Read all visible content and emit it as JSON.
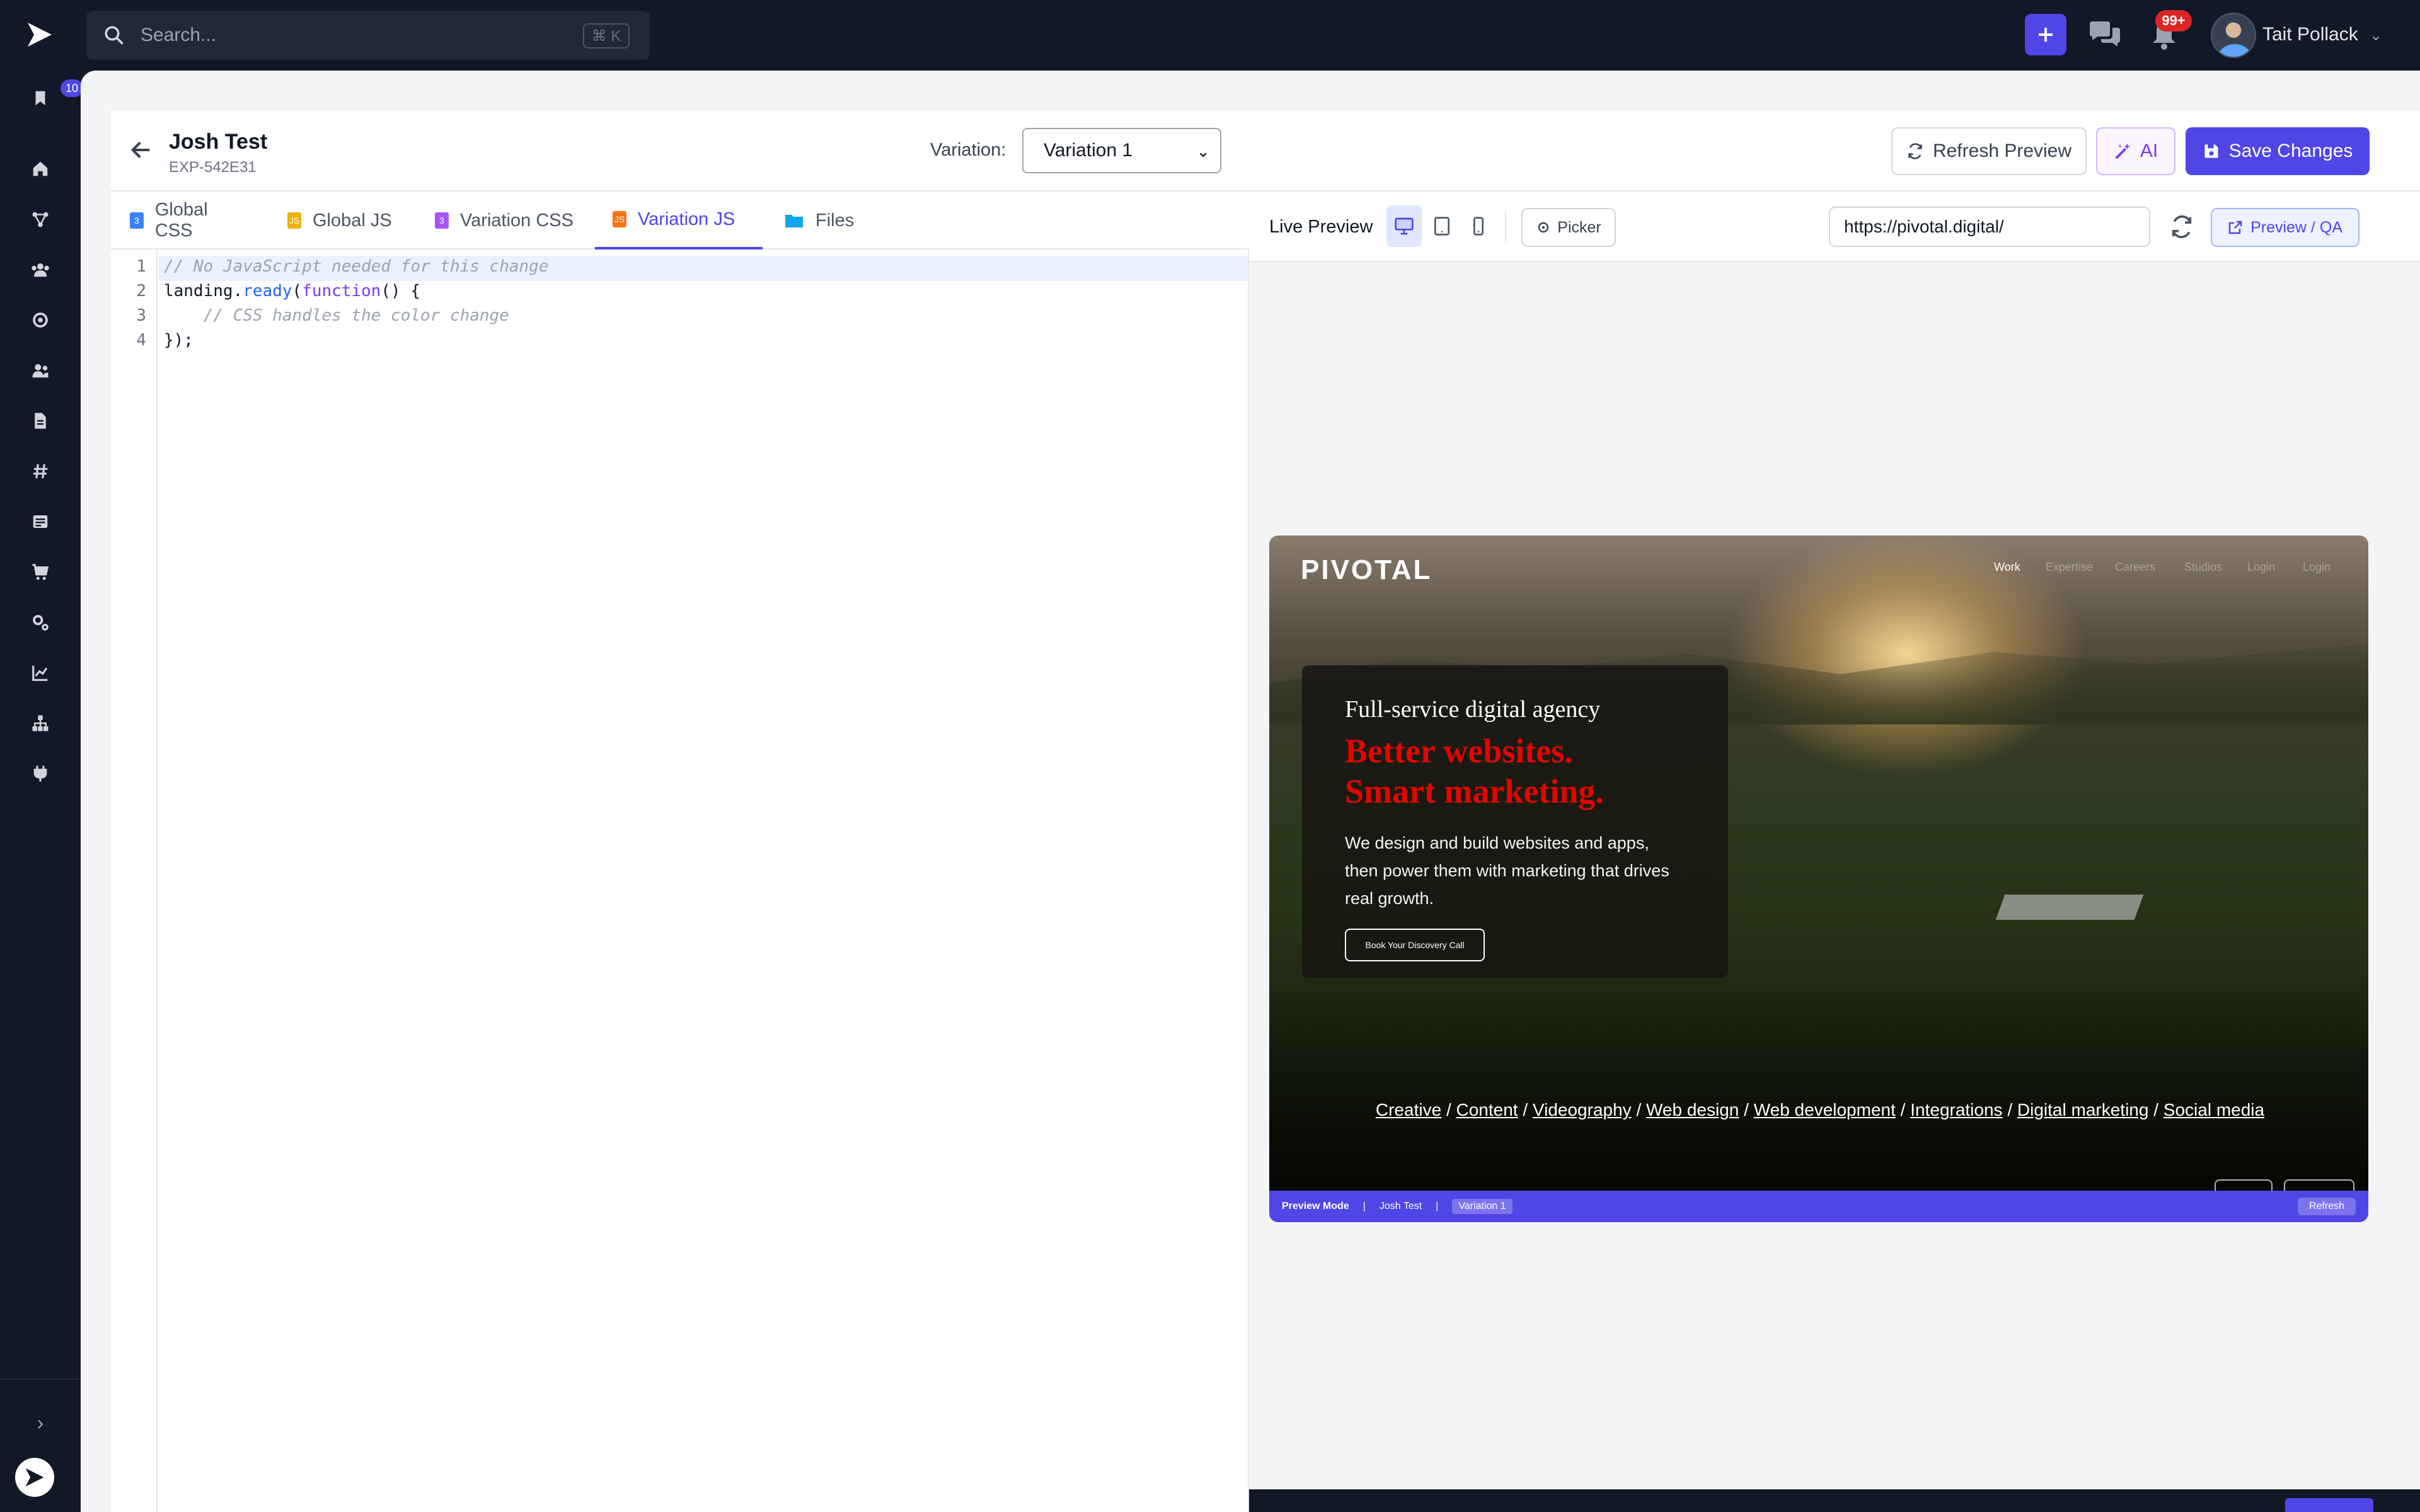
{
  "topbar": {
    "search_placeholder": "Search...",
    "search_shortcut": "⌘ K",
    "notification_count": "99+",
    "user_name": "Tait Pollack"
  },
  "sidebar": {
    "bookmark_badge": "10",
    "items": [
      "home",
      "integrations",
      "audiences",
      "experiments",
      "users",
      "pages",
      "tags",
      "content",
      "commerce",
      "settings",
      "analytics",
      "sitemap",
      "plugins"
    ]
  },
  "header": {
    "title": "Josh Test",
    "experiment_id": "EXP-542E31",
    "variation_label": "Variation:",
    "variation_value": "Variation 1",
    "refresh_label": "Refresh Preview",
    "ai_label": "AI",
    "save_label": "Save Changes"
  },
  "tabs": [
    {
      "label": "Global CSS",
      "color": "#3b82f6"
    },
    {
      "label": "Global JS",
      "color": "#eab308"
    },
    {
      "label": "Variation CSS",
      "color": "#a855f7"
    },
    {
      "label": "Variation JS",
      "color": "#f97316",
      "active": true
    },
    {
      "label": "Files",
      "color": "#0ea5e9"
    }
  ],
  "editor": {
    "line_numbers": [
      "1",
      "2",
      "3",
      "4"
    ],
    "lines": {
      "l1": "// No JavaScript needed for this change",
      "l2_obj": "landing.",
      "l2_fn": "ready",
      "l2_paren": "(",
      "l2_kw": "function",
      "l2_rest": "() {",
      "l3": "    // CSS handles the color change",
      "l4": "});"
    }
  },
  "preview": {
    "title": "Live Preview",
    "picker_label": "Picker",
    "url": "https://pivotal.digital/",
    "qa_label": "Preview / QA",
    "site": {
      "logo": "PIVOTAL",
      "nav": [
        "Work",
        "Expertise",
        "Careers",
        "Studios",
        "Login",
        "Login"
      ],
      "eyebrow": "Full-service digital agency",
      "headline_1": "Better websites.",
      "headline_2": "Smart marketing.",
      "body": "We design and build websites and apps, then power them with marketing that drives real growth.",
      "cta": "Book Your Discovery Call",
      "services": [
        "Creative",
        "Content",
        "Videography",
        "Web design",
        "Web development",
        "Integrations",
        "Digital marketing",
        "Social media"
      ],
      "separator": "/"
    },
    "qa_bar": {
      "mode": "Preview Mode",
      "sep": "|",
      "experiment": "Josh Test",
      "variation": "Variation 1",
      "refresh": "Refresh"
    }
  },
  "colors": {
    "accent": "#4f46e5",
    "headline_red": "#e10600",
    "dark": "#111827"
  }
}
